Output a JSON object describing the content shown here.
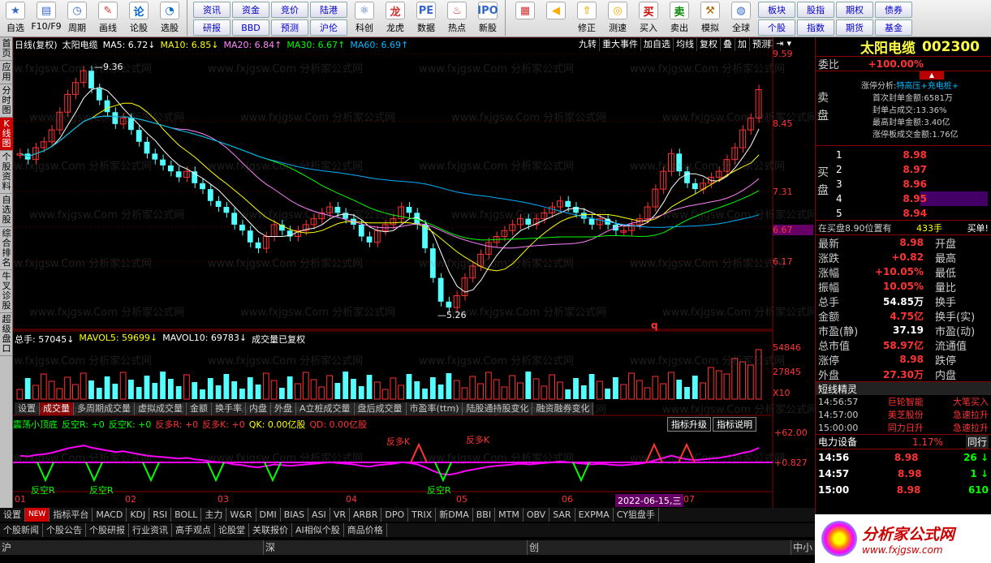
{
  "toolbar": {
    "buttons": [
      {
        "label": "自选",
        "icon": "star-icon"
      },
      {
        "label": "F10/F9",
        "icon": "f10-icon"
      },
      {
        "label": "周期",
        "icon": "clock-icon"
      },
      {
        "label": "画线",
        "icon": "pencil-icon"
      },
      {
        "label": "论股",
        "icon": "discuss-icon"
      },
      {
        "label": "选股",
        "icon": "chart-select-icon"
      }
    ],
    "grid1": [
      "资讯",
      "资金",
      "竞价",
      "陆港",
      "研报",
      "BBD",
      "预测",
      "沪伦"
    ],
    "buttons2": [
      {
        "label": "科创",
        "icon": "science-icon"
      },
      {
        "label": "龙虎",
        "icon": "dragon-icon"
      },
      {
        "label": "数据",
        "icon": "pe-icon",
        "text": "PE"
      },
      {
        "label": "热点",
        "icon": "hot-icon"
      },
      {
        "label": "新股",
        "icon": "ipo-icon",
        "text": "IPO"
      }
    ],
    "buttons3": [
      {
        "label": "",
        "icon": "color-grid-icon"
      },
      {
        "label": "",
        "icon": "back-arrow-icon"
      },
      {
        "label": "修正",
        "icon": "correct-icon"
      },
      {
        "label": "测速",
        "icon": "speed-icon"
      },
      {
        "label": "买入",
        "icon": "buy-icon",
        "text": "买"
      },
      {
        "label": "卖出",
        "icon": "sell-icon",
        "text": "卖"
      },
      {
        "label": "模拟",
        "icon": "hammer-icon"
      },
      {
        "label": "全球",
        "icon": "globe-icon"
      }
    ],
    "grid2": [
      "板块",
      "股指",
      "期权",
      "债券",
      "个股",
      "指数",
      "期货",
      "基金"
    ]
  },
  "leftbar": [
    "首页",
    "应用",
    "分时图",
    "K线图",
    "个股资料",
    "自选股",
    "综合排名",
    "牛叉诊股",
    "超级盘口"
  ],
  "chart": {
    "title_line": {
      "mode": "日线(复权)",
      "name": "太阳电缆",
      "ma5": "MA5: 6.72↓",
      "ma10": "MA10: 6.85↓",
      "ma20": "MA20: 6.84↑",
      "ma30": "MA30: 6.67↑",
      "ma60": "MA60: 6.69↑"
    },
    "top_buttons": [
      "九转",
      "重大事件",
      "加自选",
      "均线",
      "复权",
      "叠",
      "加",
      "预测"
    ],
    "price_ticks": [
      "9.59",
      "8.45",
      "7.31",
      "6.67",
      "6.17"
    ],
    "high_label": "9.36",
    "low_label": "5.26",
    "marker_q": "q",
    "volume_line": {
      "total": "总手: 57045↓",
      "mavol5": "MAVOL5: 59699↓",
      "mavol10": "MAVOL10: 69783↓",
      "note": "成交量已复权"
    },
    "volume_ticks": [
      "54846",
      "27845",
      "X10"
    ],
    "vol_tabs": [
      "设置",
      "成交量",
      "多周期成交量",
      "虚拟成交量",
      "金额",
      "换手率",
      "内盘",
      "外盘",
      "A立桩成交量",
      "盘后成交量",
      "市盈率(ttm)",
      "陆股通持股变化",
      "融资融券变化"
    ],
    "indicator_line": {
      "name": "震荡小顶底",
      "a": "反空R: +0",
      "b": "反空K: +0",
      "c": "反多R: +0",
      "d": "反多K: +0",
      "e": "QK: 0.00亿股",
      "f": "QD: 0.00亿股"
    },
    "indicator_btns": [
      "指标升级",
      "指标说明"
    ],
    "indicator_ticks": [
      "+62.00",
      "+0.827"
    ],
    "ind_labels": [
      "反空R",
      "反空R",
      "反空R",
      "反多K",
      "反多K"
    ],
    "months": [
      "01",
      "02",
      "03",
      "04",
      "05",
      "06",
      "07"
    ],
    "date_highlight": "2022-06-15,三"
  },
  "ind_tabs": [
    "设置",
    "NEW",
    "指标平台",
    "MACD",
    "KDJ",
    "RSI",
    "BOLL",
    "主力",
    "W&R",
    "DMI",
    "BIAS",
    "ASI",
    "VR",
    "ARBR",
    "DPO",
    "TRIX",
    "新DMA",
    "BBI",
    "MTM",
    "OBV",
    "SAR",
    "EXPMA",
    "CY狙盘手"
  ],
  "bottom_tabs": [
    "个股新闻",
    "个股公告",
    "个股研报",
    "行业资讯",
    "高手观点",
    "论股堂",
    "关联报价",
    "AI相似个股",
    "商品价格"
  ],
  "status": {
    "a": "沪",
    "b": "深",
    "c": "创",
    "d": "中小"
  },
  "right": {
    "name": "太阳电缆",
    "code": "002300",
    "weibi_label": "委比",
    "weibi": "+100.00%",
    "sell_label": "卖盘",
    "limit_title": "涨停分析:",
    "limit_tags": "特高压+充电桩+",
    "limit_rows": [
      "首次封单金额:6581万",
      "封单占成交:13.36%",
      "最高封单金额:3.40亿",
      "涨停板成交金额:1.76亿"
    ],
    "buy_label": "买盘",
    "bids": [
      {
        "n": "1",
        "p": "8.98"
      },
      {
        "n": "2",
        "p": "8.97"
      },
      {
        "n": "3",
        "p": "8.96"
      },
      {
        "n": "4",
        "p": "8.95"
      },
      {
        "n": "5",
        "p": "8.94"
      }
    ],
    "queue": "在买盘8.90位置有",
    "queue_vol": "433手",
    "queue_btn": "买单!",
    "stats": [
      [
        "最新",
        "8.98",
        "开盘",
        ""
      ],
      [
        "涨跌",
        "+0.82",
        "最高",
        ""
      ],
      [
        "涨幅",
        "+10.05%",
        "最低",
        ""
      ],
      [
        "振幅",
        "10.05%",
        "量比",
        ""
      ],
      [
        "总手",
        "54.85万",
        "换手",
        ""
      ],
      [
        "金额",
        "4.75亿",
        "换手(实)",
        ""
      ],
      [
        "市盈(静)",
        "37.19",
        "市盈(动)",
        ""
      ],
      [
        "总市值",
        "58.97亿",
        "流通值",
        ""
      ],
      [
        "涨停",
        "8.98",
        "跌停",
        ""
      ],
      [
        "外盘",
        "27.30万",
        "内盘",
        ""
      ]
    ],
    "news_title": "短线精灵",
    "news": [
      {
        "t": "14:56:57",
        "n": "巨轮智能",
        "e": "大笔买入"
      },
      {
        "t": "14:57:00",
        "n": "美芝股份",
        "e": "急速拉升"
      },
      {
        "t": "15:00:00",
        "n": "同力日升",
        "e": "急速拉升"
      }
    ],
    "sector": "电力设备",
    "sector_pct": "1.17%",
    "sector_btn": "同行",
    "ticks": [
      {
        "t": "14:56",
        "p": "8.98",
        "v": "26"
      },
      {
        "t": "14:57",
        "p": "8.98",
        "v": "1"
      },
      {
        "t": "15:00",
        "p": "8.98",
        "v": "610"
      }
    ]
  },
  "watermark": "www.fxjgsw.Com 分析家公式网",
  "logo": {
    "name": "分析家公式网",
    "url": "www.fxjgsw.com"
  },
  "colors": {
    "up": "#ff3232",
    "down": "#54ffff",
    "ma5": "#ffffff",
    "ma10": "#ffff00",
    "ma20": "#ff80ff",
    "ma30": "#00ff00",
    "ma60": "#00b0ff"
  }
}
